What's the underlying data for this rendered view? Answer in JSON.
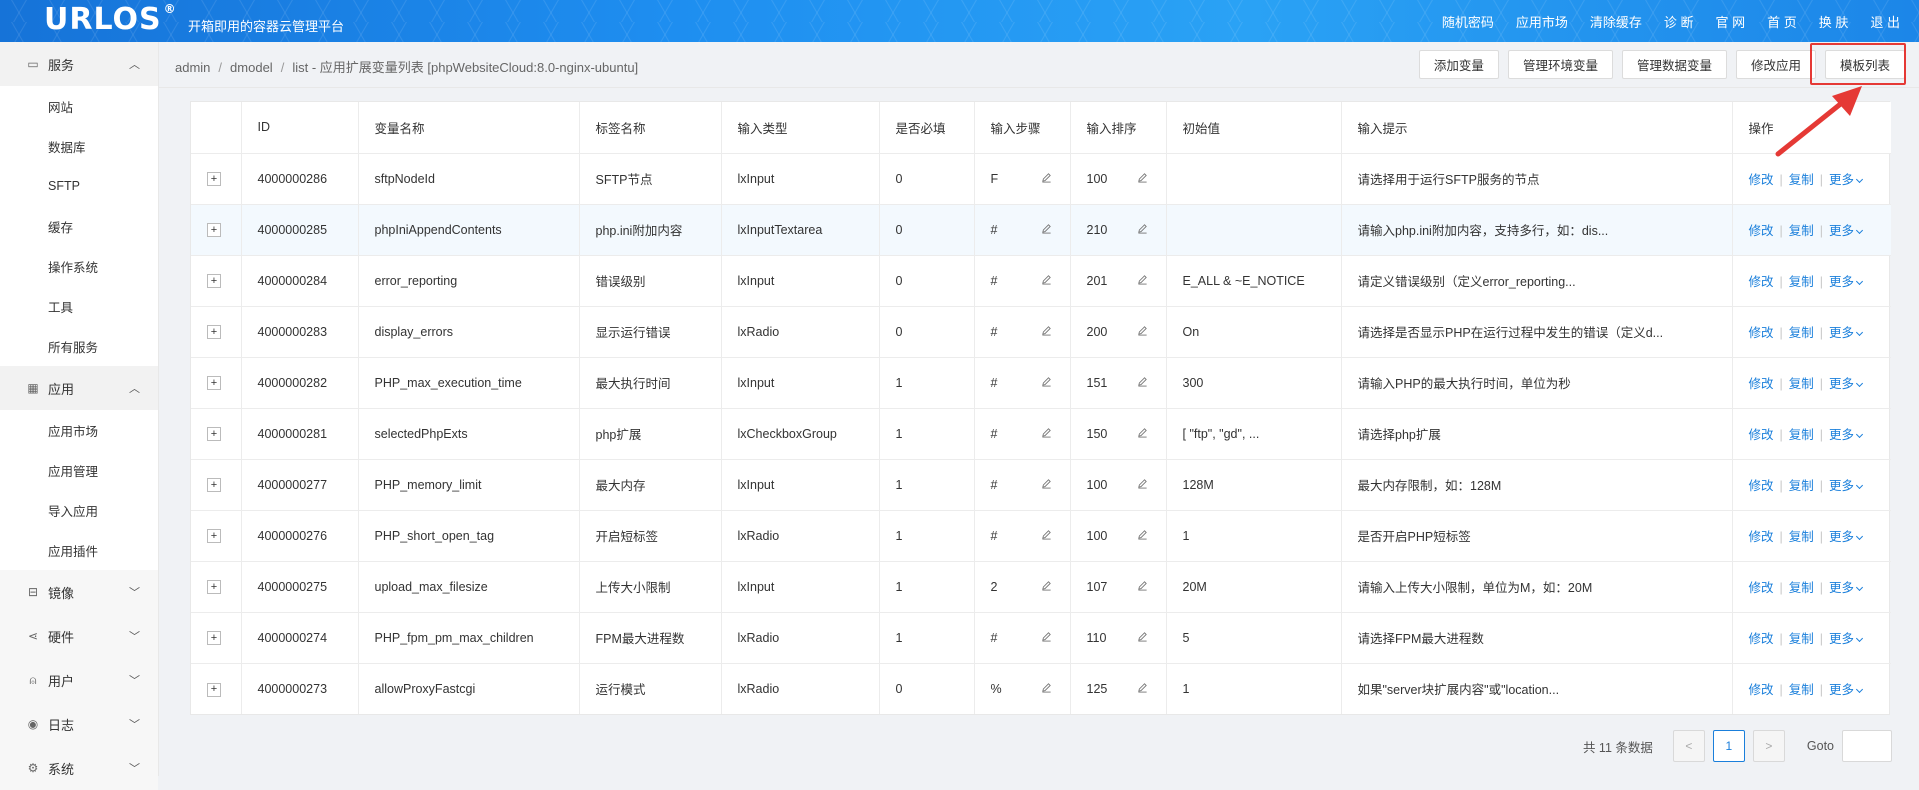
{
  "header": {
    "logo": "URLOS",
    "logo_mark": "®",
    "slogan": "开箱即用的容器云管理平台",
    "nav": [
      "随机密码",
      "应用市场",
      "清除缓存",
      "诊 断",
      "官 网",
      "首 页",
      "换 肤",
      "退 出"
    ]
  },
  "sidebar": {
    "groups": [
      {
        "label": "服务",
        "icon": "server-icon",
        "expanded": true,
        "items": [
          "网站",
          "数据库",
          "SFTP",
          "缓存",
          "操作系统",
          "工具",
          "所有服务"
        ]
      },
      {
        "label": "应用",
        "icon": "grid-icon",
        "expanded": true,
        "items": [
          "应用市场",
          "应用管理",
          "导入应用",
          "应用插件"
        ]
      },
      {
        "label": "镜像",
        "icon": "disk-icon",
        "expanded": false,
        "items": []
      },
      {
        "label": "硬件",
        "icon": "share-icon",
        "expanded": false,
        "items": []
      },
      {
        "label": "用户",
        "icon": "user-icon",
        "expanded": false,
        "items": []
      },
      {
        "label": "日志",
        "icon": "eye-icon",
        "expanded": false,
        "items": []
      },
      {
        "label": "系统",
        "icon": "settings-icon",
        "expanded": false,
        "items": []
      }
    ]
  },
  "breadcrumb": {
    "items": [
      "admin",
      "dmodel",
      "list"
    ],
    "title": "应用扩展变量列表 [phpWebsiteCloud:8.0-nginx-ubuntu]"
  },
  "actions": [
    "添加变量",
    "管理环境变量",
    "管理数据变量",
    "修改应用",
    "模板列表"
  ],
  "table": {
    "columns": [
      "",
      "ID",
      "变量名称",
      "标签名称",
      "输入类型",
      "是否必填",
      "输入步骤",
      "输入排序",
      "初始值",
      "输入提示",
      "操作"
    ],
    "rows": [
      [
        "4000000286",
        "sftpNodeId",
        "SFTP节点",
        "lxInput",
        "0",
        "F",
        "100",
        "",
        "请选择用于运行SFTP服务的节点"
      ],
      [
        "4000000285",
        "phpIniAppendContents",
        "php.ini附加内容",
        "lxInputTextarea",
        "0",
        "#",
        "210",
        "",
        "请输入php.ini附加内容，支持多行，如：dis..."
      ],
      [
        "4000000284",
        "error_reporting",
        "错误级别",
        "lxInput",
        "0",
        "#",
        "201",
        "E_ALL & ~E_NOTICE",
        "请定义错误级别（定义error_reporting..."
      ],
      [
        "4000000283",
        "display_errors",
        "显示运行错误",
        "lxRadio",
        "0",
        "#",
        "200",
        "On",
        "请选择是否显示PHP在运行过程中发生的错误（定义d..."
      ],
      [
        "4000000282",
        "PHP_max_execution_time",
        "最大执行时间",
        "lxInput",
        "1",
        "#",
        "151",
        "300",
        "请输入PHP的最大执行时间，单位为秒"
      ],
      [
        "4000000281",
        "selectedPhpExts",
        "php扩展",
        "lxCheckboxGroup",
        "1",
        "#",
        "150",
        "[ \"ftp\", \"gd\", ...",
        "请选择php扩展"
      ],
      [
        "4000000277",
        "PHP_memory_limit",
        "最大内存",
        "lxInput",
        "1",
        "#",
        "100",
        "128M",
        "最大内存限制，如：128M"
      ],
      [
        "4000000276",
        "PHP_short_open_tag",
        "开启短标签",
        "lxRadio",
        "1",
        "#",
        "100",
        "1",
        "是否开启PHP短标签"
      ],
      [
        "4000000275",
        "upload_max_filesize",
        "上传大小限制",
        "lxInput",
        "1",
        "2",
        "107",
        "20M",
        "请输入上传大小限制，单位为M，如：20M"
      ],
      [
        "4000000274",
        "PHP_fpm_pm_max_children",
        "FPM最大进程数",
        "lxRadio",
        "1",
        "#",
        "110",
        "5",
        "请选择FPM最大进程数"
      ],
      [
        "4000000273",
        "allowProxyFastcgi",
        "运行模式",
        "lxRadio",
        "0",
        "%",
        "125",
        "1",
        "如果\"server块扩展内容\"或\"location..."
      ]
    ],
    "row_actions": {
      "edit": "修改",
      "copy": "复制",
      "more": "更多"
    },
    "expand_symbol": "+"
  },
  "pagination": {
    "total": "共 11 条数据",
    "current_page": "1",
    "prev": "<",
    "next": ">",
    "goto_label": "Goto"
  },
  "colors": {
    "accent": "#1a7fdb",
    "highlight": "#e53935"
  }
}
